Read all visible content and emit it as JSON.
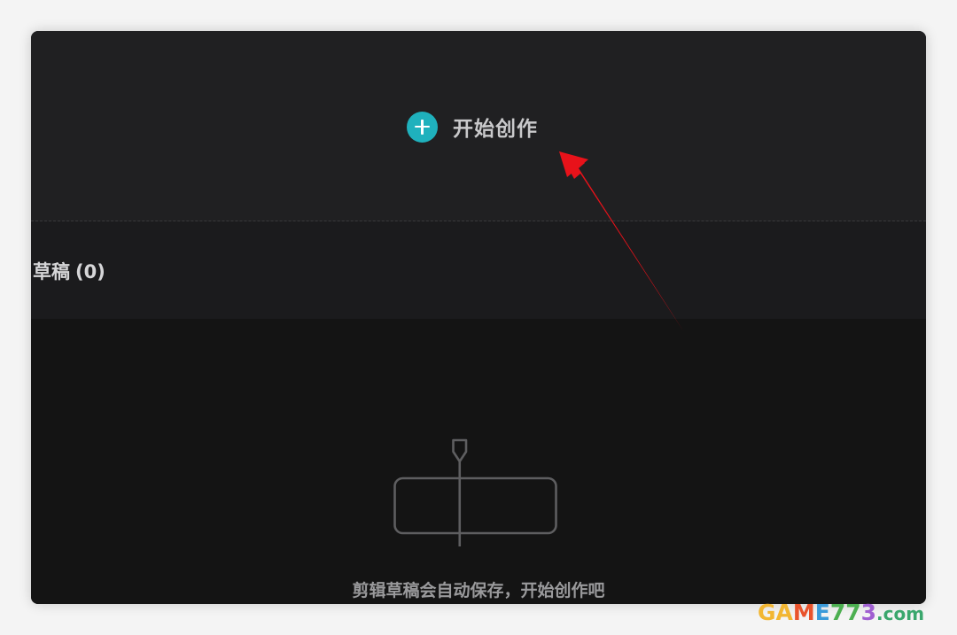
{
  "create": {
    "label": "开始创作",
    "icon": "plus-icon",
    "accent_color": "#1fb1bd"
  },
  "drafts": {
    "title": "草稿",
    "count": "(0)"
  },
  "empty_state": {
    "icon": "timeline-clip-icon",
    "message": "剪辑草稿会自动保存，开始创作吧"
  },
  "annotation": {
    "color": "#e8121a"
  },
  "watermark": {
    "part1": "GA",
    "part2": "M",
    "part3": "E",
    "part4": "77",
    "part5": "3",
    "domain": ".com"
  }
}
